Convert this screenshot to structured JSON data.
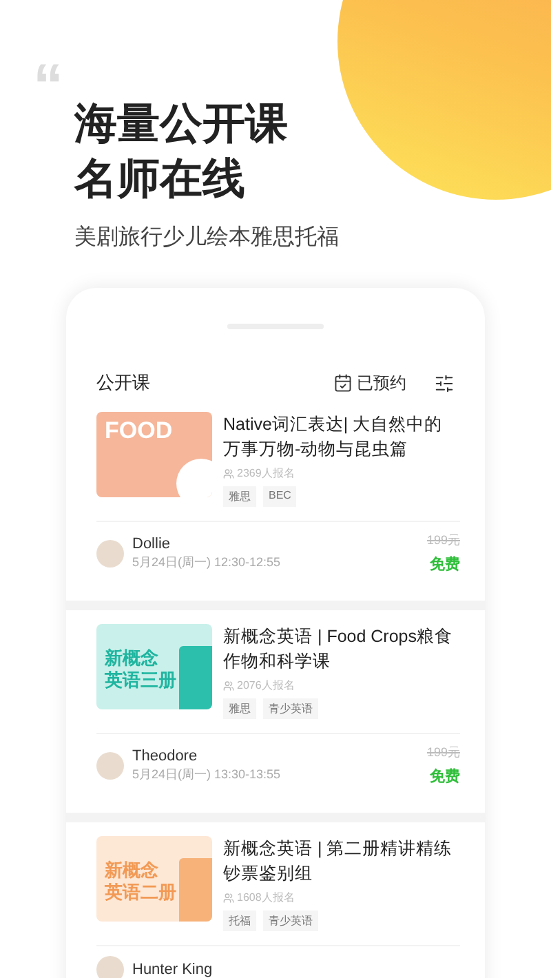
{
  "hero": {
    "quote_mark": "“",
    "headline": [
      "海量公开课",
      "名师在线"
    ],
    "subtitle": "美剧旅行少儿绘本雅思托福"
  },
  "header": {
    "title": "公开课",
    "booked": "已预约"
  },
  "courses": [
    {
      "kind": "food",
      "cover_text": [
        "FOOD"
      ],
      "title": "Native词汇表达| 大自然中的万事万物-动物与昆虫篇",
      "enrolled": "2369人报名",
      "tags": [
        "雅思",
        "BEC"
      ],
      "teacher": "Dollie",
      "time": "5月24日(周一) 12:30-12:55",
      "old_price": "199元",
      "price": "免费"
    },
    {
      "kind": "teal",
      "cover_text": [
        "新概念",
        "英语三册"
      ],
      "title": "新概念英语 | Food Crops粮食作物和科学课",
      "enrolled": "2076人报名",
      "tags": [
        "雅思",
        "青少英语"
      ],
      "teacher": "Theodore",
      "time": "5月24日(周一) 13:30-13:55",
      "old_price": "199元",
      "price": "免费"
    },
    {
      "kind": "orange",
      "cover_text": [
        "新概念",
        "英语二册"
      ],
      "title": "新概念英语 | 第二册精讲精练钞票鉴别组",
      "enrolled": "1608人报名",
      "tags": [
        "托福",
        "青少英语"
      ],
      "teacher": "Hunter King"
    }
  ]
}
